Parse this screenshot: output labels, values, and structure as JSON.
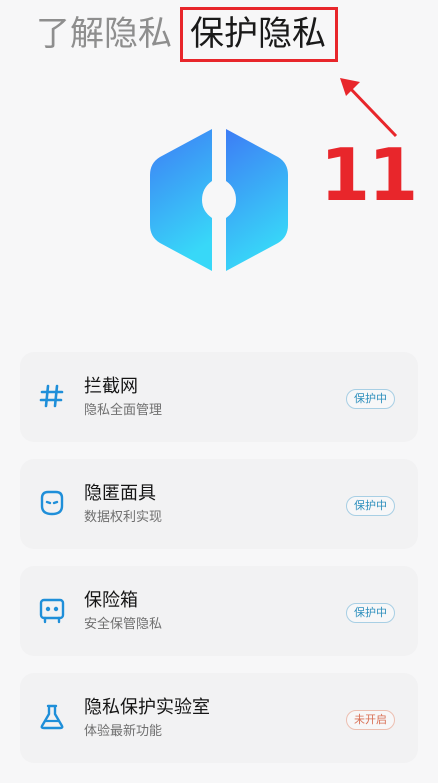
{
  "tabs": {
    "inactive_label": "了解隐私",
    "active_label": "保护隐私"
  },
  "annotation": {
    "number": "11",
    "color": "#e8262b"
  },
  "cards": [
    {
      "title": "拦截网",
      "subtitle": "隐私全面管理",
      "badge": "保护中",
      "icon": "hash-icon"
    },
    {
      "title": "隐匿面具",
      "subtitle": "数据权利实现",
      "badge": "保护中",
      "icon": "mask-icon"
    },
    {
      "title": "保险箱",
      "subtitle": "安全保管隐私",
      "badge": "保护中",
      "icon": "safe-box-icon"
    },
    {
      "title": "隐私保护实验室",
      "subtitle": "体验最新功能",
      "badge": "未开启",
      "icon": "flask-icon"
    }
  ],
  "colors": {
    "accent": "#1f8fd9",
    "badge_on": "#2e8fbd",
    "badge_off": "#d86f54",
    "logo_top": "#3d7cf5",
    "logo_bottom": "#38d8f8"
  }
}
